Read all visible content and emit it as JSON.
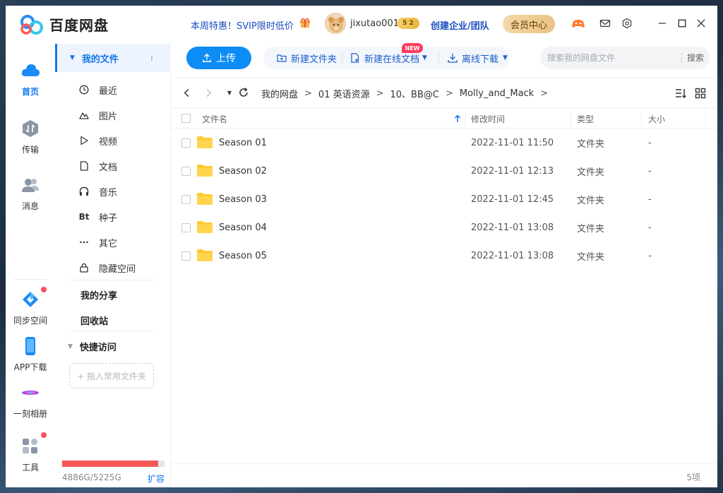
{
  "app": {
    "title": "百度网盘"
  },
  "header": {
    "promo": "本周特惠！SVIP限时低价",
    "username": "jixutao001",
    "level": "5 2",
    "enterprise": "创建企业/团队",
    "vip_center": "会员中心"
  },
  "leftnav": {
    "items": [
      {
        "label": "首页",
        "icon": "cloud-icon"
      },
      {
        "label": "传输",
        "icon": "transfer-icon"
      },
      {
        "label": "消息",
        "icon": "contacts-icon"
      },
      {
        "label": "同步空间",
        "icon": "sync-icon"
      },
      {
        "label": "APP下载",
        "icon": "phone-icon"
      },
      {
        "label": "一刻相册",
        "icon": "album-icon"
      },
      {
        "label": "工具",
        "icon": "tools-icon"
      }
    ]
  },
  "sidebar": {
    "my_files": "我的文件",
    "categories": [
      {
        "label": "最近",
        "icon": "clock-icon"
      },
      {
        "label": "图片",
        "icon": "image-icon"
      },
      {
        "label": "视频",
        "icon": "play-icon"
      },
      {
        "label": "文档",
        "icon": "document-icon"
      },
      {
        "label": "音乐",
        "icon": "headphones-icon"
      },
      {
        "label": "种子",
        "icon": "torrent-icon",
        "glyph": "Bt"
      },
      {
        "label": "其它",
        "icon": "more-icon",
        "glyph": "···"
      },
      {
        "label": "隐藏空间",
        "icon": "lock-icon"
      }
    ],
    "my_share": "我的分享",
    "recycle": "回收站",
    "quick_access": "快捷访问",
    "drop_hint": "+ 拖入常用文件夹",
    "storage_text": "4886G/5225G",
    "storage_used_fraction": 0.935,
    "expand": "扩容"
  },
  "toolbar": {
    "upload": "上传",
    "new_folder": "新建文件夹",
    "new_doc": "新建在线文档",
    "new_badge": "NEW",
    "offline": "离线下载",
    "search_placeholder": "搜索我的网盘文件",
    "search_btn": "搜索"
  },
  "breadcrumb": [
    "我的网盘",
    "01 英语资源",
    "10、BB@C",
    "Molly_and_Mack"
  ],
  "table": {
    "headers": {
      "name": "文件名",
      "time": "修改时间",
      "type": "类型",
      "size": "大小"
    },
    "rows": [
      {
        "name": "Season 01",
        "time": "2022-11-01 11:50",
        "type": "文件夹",
        "size": "-"
      },
      {
        "name": "Season 02",
        "time": "2022-11-01 12:13",
        "type": "文件夹",
        "size": "-"
      },
      {
        "name": "Season 03",
        "time": "2022-11-01 12:45",
        "type": "文件夹",
        "size": "-"
      },
      {
        "name": "Season 04",
        "time": "2022-11-01 13:08",
        "type": "文件夹",
        "size": "-"
      },
      {
        "name": "Season 05",
        "time": "2022-11-01 13:08",
        "type": "文件夹",
        "size": "-"
      }
    ]
  },
  "footer": {
    "count": "5项"
  },
  "colors": {
    "accent": "#1377ec",
    "upload": "#0d8cf5",
    "folder": "#ffc933",
    "storage": "#f45757"
  }
}
